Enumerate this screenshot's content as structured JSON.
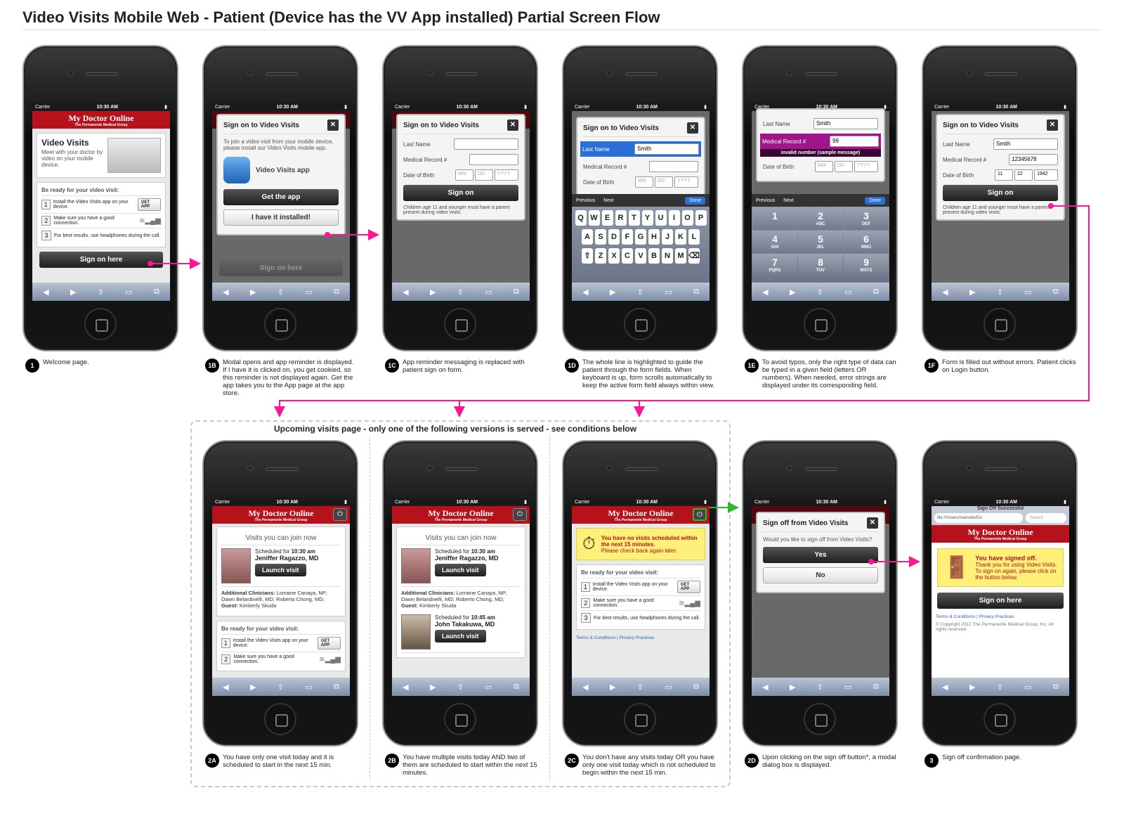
{
  "title": "Video Visits Mobile Web - Patient (Device has the VV App installed) Partial Screen Flow",
  "common": {
    "carrier": "Carrier",
    "time": "10:30 AM",
    "brand": "My Doctor Online",
    "brand_sub": "The Permanente Medical Group",
    "close": "✕"
  },
  "s1": {
    "heading": "Video Visits",
    "intro": "Meet with your doctor by video on your mobile device.",
    "ready": "Be ready for your video visit:",
    "steps": [
      {
        "n": "1",
        "text": "Install the Video Visits app on your device.",
        "btn": "GET APP"
      },
      {
        "n": "2",
        "text": "Make sure you have a good connection."
      },
      {
        "n": "3",
        "text": "For best results, use headphones during the call."
      }
    ],
    "signon": "Sign on here"
  },
  "s1b": {
    "header": "Sign on to Video Visits",
    "body": "To join a video visit from your mobile device, please install our Video Visits mobile app.",
    "app_name": "Video Visits app",
    "get_app": "Get the app",
    "installed": "I have it installed!"
  },
  "form": {
    "header": "Sign on to Video Visits",
    "last_name": "Last Name",
    "med_rec": "Medical Record #",
    "dob": "Date of Birth",
    "mm": "MM",
    "dd": "DD",
    "yyyy": "YYYY",
    "signon": "Sign on",
    "note": "Children age 11 and younger must have a parent present during video visits.",
    "prev": "Previous",
    "next": "Next",
    "done": "Done",
    "smith": "Smith",
    "err_value": "99",
    "err_msg": "invalid number (sample message)",
    "full_record": "12345678",
    "full_mm": "11",
    "full_dd": "22",
    "full_yyyy": "1942"
  },
  "keyboard": {
    "row1": [
      "Q",
      "W",
      "E",
      "R",
      "T",
      "Y",
      "U",
      "I",
      "O",
      "P"
    ],
    "row2": [
      "A",
      "S",
      "D",
      "F",
      "G",
      "H",
      "J",
      "K",
      "L"
    ],
    "row3": [
      "⇧",
      "Z",
      "X",
      "C",
      "V",
      "B",
      "N",
      "M",
      "⌫"
    ]
  },
  "numpad": [
    {
      "n": "1",
      "l": ""
    },
    {
      "n": "2",
      "l": "ABC"
    },
    {
      "n": "3",
      "l": "DEF"
    },
    {
      "n": "4",
      "l": "GHI"
    },
    {
      "n": "5",
      "l": "JKL"
    },
    {
      "n": "6",
      "l": "MNO"
    },
    {
      "n": "7",
      "l": "PQRS"
    },
    {
      "n": "8",
      "l": "TUV"
    },
    {
      "n": "9",
      "l": "WXYZ"
    }
  ],
  "visits": {
    "heading": "Visits you can join now",
    "scheduled_for": "Scheduled for",
    "v1_time": "10:30 am",
    "v1_name": "Jeniffer Ragazzo, MD",
    "v2_time": "10:45 am",
    "v2_name": "John Takakuwa, MD",
    "launch": "Launch visit",
    "addl_label": "Additional Clinicians:",
    "addl_text": "Lorraine Canaya, NP; Dawn Belardinelli, MD; Roberto Chong, MD;",
    "guest_label": "Guest:",
    "guest": "Kimberly Skuda",
    "ready": "Be ready for your video visit:"
  },
  "novisit": {
    "h": "You have no visits scheduled within the next 15 minutes.",
    "sub": "Please check back again later.",
    "terms": "Terms & Conditions",
    "privacy": "Privacy Practices"
  },
  "signoff": {
    "header": "Sign off from Video Visits",
    "body": "Would you like to sign off from Video Visits?",
    "yes": "Yes",
    "no": "No"
  },
  "confirm": {
    "tab_title": "Sign Off Successful",
    "url": "file:///Users/marcello/Do",
    "search": "Search",
    "h": "You have signed off.",
    "body": "Thank you for using Video Visits. To sign on again, please click on the button below.",
    "btn": "Sign on here",
    "copyright": "© Copyright 2012 The Permanente Medical Group, Inc. All rights reserved."
  },
  "group_label": "Upcoming visits page - only one of the following versions is served - see conditions below",
  "captions": [
    {
      "badge": "1",
      "text": "Welcome page."
    },
    {
      "badge": "1B",
      "text": "Modal opens and app reminder is displayed. If I have it is clicked on, you get cookied, so this reminder is not displayed again. Get the app takes you to the App page at the app store."
    },
    {
      "badge": "1C",
      "text": "App reminder messaging is replaced with patient sign on form."
    },
    {
      "badge": "1D",
      "text": "The whole line is highlighted to guide the patient through the form fields. When keyboard is up, form scrolls automatically to keep the active form field always within view."
    },
    {
      "badge": "1E",
      "text": "To avoid typos, only the right type of data can be typed in a given field (letters OR numbers). When needed, error strings are displayed under its corresponding field."
    },
    {
      "badge": "1F",
      "text": "Form is filled out without errors. Patient clicks on Login button."
    },
    {
      "badge": "2A",
      "text": "You have only one visit today and it is scheduled to start in the next 15 min."
    },
    {
      "badge": "2B",
      "text": "You have multiple visits today AND two of them are scheduled to start within the next 15 minutes."
    },
    {
      "badge": "2C",
      "text": "You don't have any visits today OR you have only one visit today which is not scheduled to begin within the next 15 min."
    },
    {
      "badge": "2D",
      "text": "Upon clicking on the sign off button*, a modal dialog box is displayed."
    },
    {
      "badge": "3",
      "text": "Sign off confirmation page."
    }
  ],
  "colors": {
    "brand_red": "#b5121b",
    "arrow_pink": "#ff1493",
    "highlight_green": "#2db82d",
    "error_purple": "#a0158a"
  }
}
